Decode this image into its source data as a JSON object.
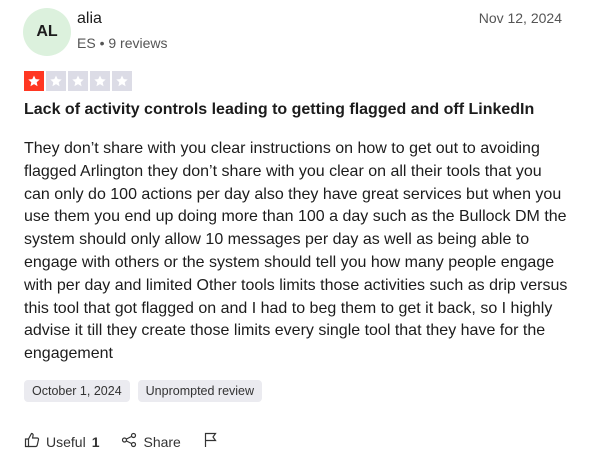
{
  "review": {
    "avatar_initials": "AL",
    "reviewer_name": "alia",
    "reviewer_meta": "ES • 9 reviews",
    "date": "Nov 12, 2024",
    "rating": 1,
    "max_rating": 5,
    "title": "Lack of activity controls leading to getting flagged and off LinkedIn",
    "body": "They don’t share with you clear instructions on how to get out to avoiding flagged Arlington they don’t share with you clear on all their tools that you can only do 100 actions per day also they have great services but when you use them you end up doing more than 100 a day such as the Bullock DM the system should only allow 10 messages per day as well as being able to engage with others or the system should tell you how many people engage with per day and limited Other tools limits those activities such as drip versus this tool that got flagged on and I had to beg them to get it back, so I highly advise it till they create those limits every single tool that they have for the engagement",
    "experience_date": "October 1, 2024",
    "review_type": "Unprompted review"
  },
  "actions": {
    "useful_label": "Useful",
    "useful_count": "1",
    "share_label": "Share"
  },
  "colors": {
    "star_on": "#ff3722",
    "star_off": "#dcdce6",
    "avatar_bg": "#dcf1dd"
  },
  "icons": {
    "useful": "thumbs-up-icon",
    "share": "share-icon",
    "report": "flag-icon"
  }
}
